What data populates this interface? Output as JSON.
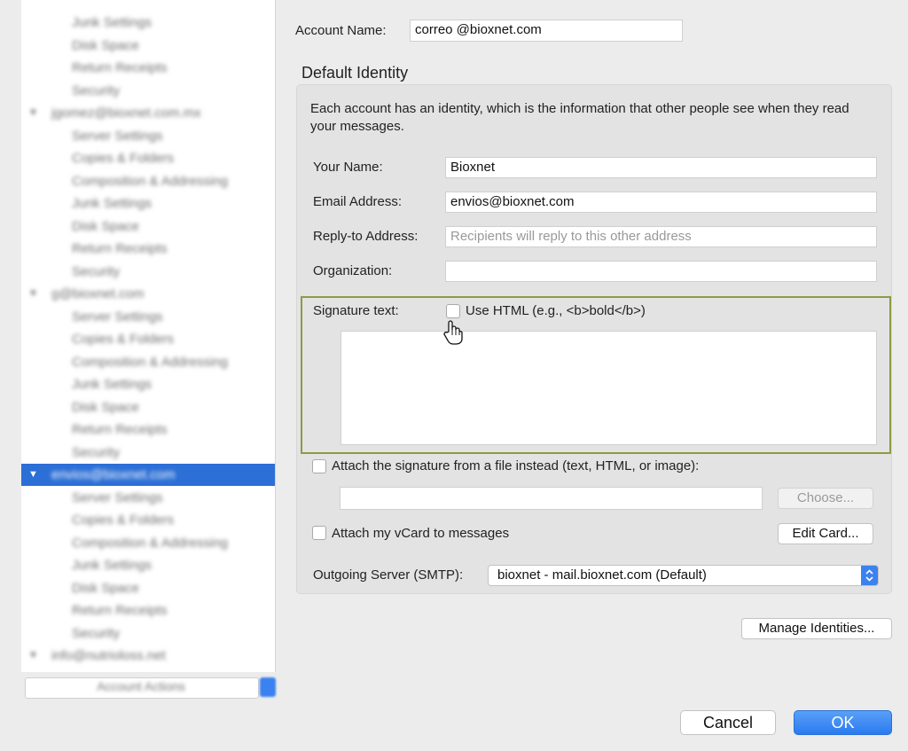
{
  "account_tree": {
    "rows": [
      {
        "label": "Junk Settings",
        "type": "child"
      },
      {
        "label": "Disk Space",
        "type": "child"
      },
      {
        "label": "Return Receipts",
        "type": "child"
      },
      {
        "label": "Security",
        "type": "child"
      },
      {
        "label": "jgomez@bioxnet.com.mx",
        "type": "parent"
      },
      {
        "label": "Server Settings",
        "type": "child"
      },
      {
        "label": "Copies & Folders",
        "type": "child"
      },
      {
        "label": "Composition & Addressing",
        "type": "child"
      },
      {
        "label": "Junk Settings",
        "type": "child"
      },
      {
        "label": "Disk Space",
        "type": "child"
      },
      {
        "label": "Return Receipts",
        "type": "child"
      },
      {
        "label": "Security",
        "type": "child"
      },
      {
        "label": "g@bioxnet.com",
        "type": "parent"
      },
      {
        "label": "Server Settings",
        "type": "child"
      },
      {
        "label": "Copies & Folders",
        "type": "child"
      },
      {
        "label": "Composition & Addressing",
        "type": "child"
      },
      {
        "label": "Junk Settings",
        "type": "child"
      },
      {
        "label": "Disk Space",
        "type": "child"
      },
      {
        "label": "Return Receipts",
        "type": "child"
      },
      {
        "label": "Security",
        "type": "child"
      },
      {
        "label": "envios@bioxnet.com",
        "type": "parent",
        "selected": true
      },
      {
        "label": "Server Settings",
        "type": "child"
      },
      {
        "label": "Copies & Folders",
        "type": "child"
      },
      {
        "label": "Composition & Addressing",
        "type": "child"
      },
      {
        "label": "Junk Settings",
        "type": "child"
      },
      {
        "label": "Disk Space",
        "type": "child"
      },
      {
        "label": "Return Receipts",
        "type": "child"
      },
      {
        "label": "Security",
        "type": "child"
      },
      {
        "label": "info@nutrioloss.net",
        "type": "parent"
      }
    ],
    "account_actions_label": "Account Actions",
    "expand_glyph": "▼"
  },
  "account": {
    "name_label": "Account Name:",
    "name_value": "correo @bioxnet.com"
  },
  "identity": {
    "section_title": "Default Identity",
    "description": "Each account has an identity, which is the information that other people see when they read your messages.",
    "your_name_label": "Your Name:",
    "your_name_value": "Bioxnet",
    "email_label": "Email Address:",
    "email_value": "envios@bioxnet.com",
    "reply_to_label": "Reply-to Address:",
    "reply_to_placeholder": "Recipients will reply to this other address",
    "organization_label": "Organization:",
    "organization_value": "",
    "signature_label": "Signature text:",
    "use_html_label": "Use HTML (e.g., <b>bold</b>)",
    "signature_value": "",
    "attach_file_label": "Attach the signature from a file instead (text, HTML, or image):",
    "attach_file_path": "",
    "choose_button": "Choose...",
    "vcard_label": "Attach my vCard to messages",
    "edit_card_button": "Edit Card...",
    "smtp_label": "Outgoing Server (SMTP):",
    "smtp_value": "bioxnet - mail.bioxnet.com (Default)"
  },
  "buttons": {
    "manage_identities": "Manage Identities...",
    "cancel": "Cancel",
    "ok": "OK"
  },
  "colors": {
    "selection": "#2c6fd6",
    "highlight_border": "#8e9a45",
    "accent": "#3b82f0"
  }
}
